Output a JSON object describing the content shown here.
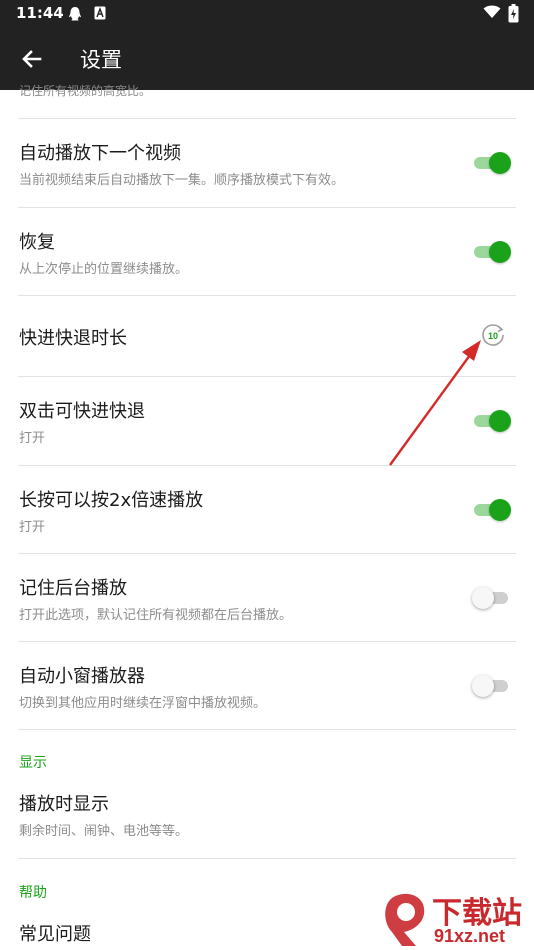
{
  "status_bar": {
    "time": "11:44",
    "icons": [
      "qq-icon",
      "font-a-icon",
      "wifi-icon",
      "battery-charging-icon"
    ]
  },
  "app_bar": {
    "title": "设置",
    "back_icon": "arrow-back-icon"
  },
  "settings": {
    "top_partial_subtitle": "记住所有视频的高宽比。",
    "items": [
      {
        "title": "自动播放下一个视频",
        "subtitle": "当前视频结束后自动播放下一集。顺序播放模式下有效。",
        "control": "toggle",
        "checked": true
      },
      {
        "title": "恢复",
        "subtitle": "从上次停止的位置继续播放。",
        "control": "toggle",
        "checked": true
      },
      {
        "title": "快进快退时长",
        "subtitle": "",
        "control": "seek-value",
        "value": "10"
      },
      {
        "title": "双击可快进快退",
        "subtitle": "打开",
        "control": "toggle",
        "checked": true
      },
      {
        "title": "长按可以按2x倍速播放",
        "subtitle": "打开",
        "control": "toggle",
        "checked": true
      },
      {
        "title": "记住后台播放",
        "subtitle": "打开此选项，默认记住所有视频都在后台播放。",
        "control": "toggle",
        "checked": false
      },
      {
        "title": "自动小窗播放器",
        "subtitle": "切换到其他应用时继续在浮窗中播放视频。",
        "control": "toggle",
        "checked": false
      }
    ],
    "section_display": {
      "header": "显示",
      "items": [
        {
          "title": "播放时显示",
          "subtitle": "剩余时间、闹钟、电池等等。"
        }
      ]
    },
    "section_help": {
      "header": "帮助",
      "items": [
        {
          "title": "常见问题"
        }
      ]
    }
  },
  "watermark": {
    "line1": "下载站",
    "line2": "91xz.net"
  },
  "colors": {
    "app_bar": "#222222",
    "accent_green": "#1aa31a",
    "arrow_red": "#d42a2a",
    "watermark_red": "#c9282d"
  }
}
